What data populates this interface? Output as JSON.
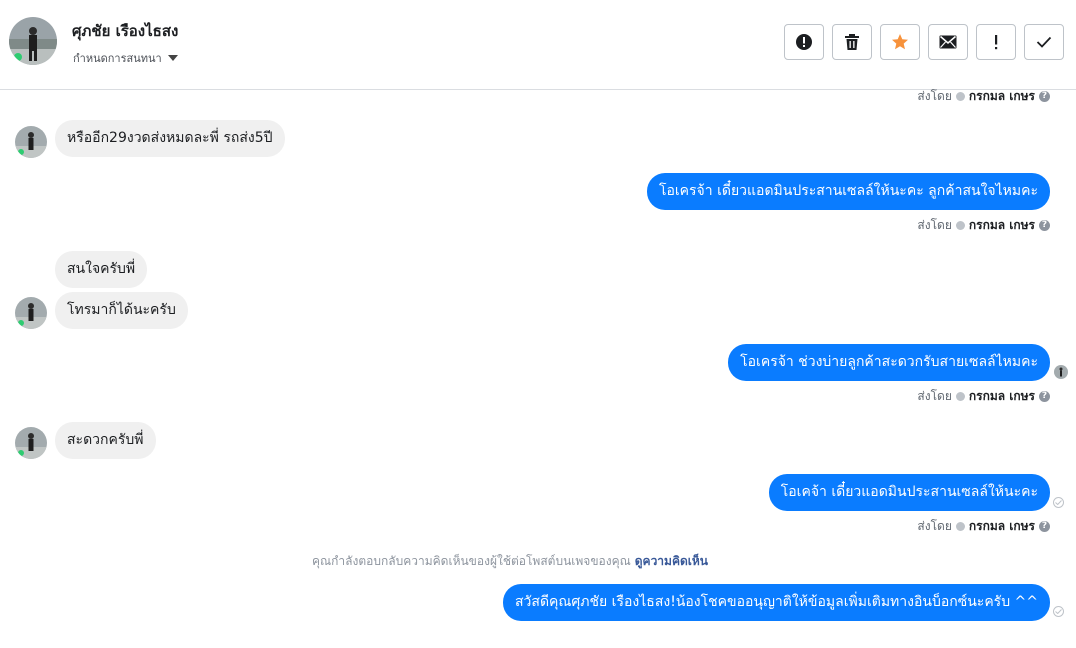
{
  "header": {
    "contact_name": "ศุภชัย เรืองไธสง",
    "conversation_settings": "กำหนดการสนทนา",
    "toolbar": [
      {
        "name": "report-button",
        "icon": "alert-circle-icon"
      },
      {
        "name": "delete-button",
        "icon": "trash-icon"
      },
      {
        "name": "star-button",
        "icon": "star-icon"
      },
      {
        "name": "mark-unread-button",
        "icon": "envelope-icon"
      },
      {
        "name": "important-button",
        "icon": "exclamation-icon"
      },
      {
        "name": "done-button",
        "icon": "check-icon"
      }
    ],
    "star_color": "#f7923b"
  },
  "meta_text": {
    "sent_by": "ส่งโดย",
    "sender_name": "กรกมล เกษร"
  },
  "messages": [
    {
      "direction": "in",
      "text": "หรืออีก29งวดส่งหมดละพี่ รถส่ง5ปี"
    },
    {
      "direction": "out",
      "text": "โอเครจ้า เดี๋ยวแอดมินประสานเซลล์ให้นะคะ ลูกค้าสนใจไหมคะ"
    },
    {
      "direction": "in",
      "text": "สนใจครับพี่"
    },
    {
      "direction": "in",
      "text": "โทรมาก็ได้นะครับ"
    },
    {
      "direction": "out",
      "text": "โอเครจ้า  ช่วงบ่ายลูกค้าสะดวกรับสายเซลล์ไหมคะ"
    },
    {
      "direction": "in",
      "text": "สะดวกครับพี่"
    },
    {
      "direction": "out",
      "text": "โอเคจ้า เดี๋ยวแอดมินประสานเซลล์ให้นะคะ"
    },
    {
      "direction": "out",
      "text": "สวัสดีคุณศุภชัย เรืองไธสง!น้องโชคขออนุญาติให้ข้อมูลเพิ่มเติมทางอินบ็อกซ์นะครับ ^^"
    }
  ],
  "notice": {
    "text": "คุณกำลังตอบกลับความคิดเห็นของผู้ใช้ต่อโพสต์บนเพจของคุณ",
    "link": "ดูความคิดเห็น"
  },
  "colors": {
    "outgoing_bubble": "#0a7cff",
    "incoming_bubble": "#f0f0f0",
    "link": "#385898"
  }
}
